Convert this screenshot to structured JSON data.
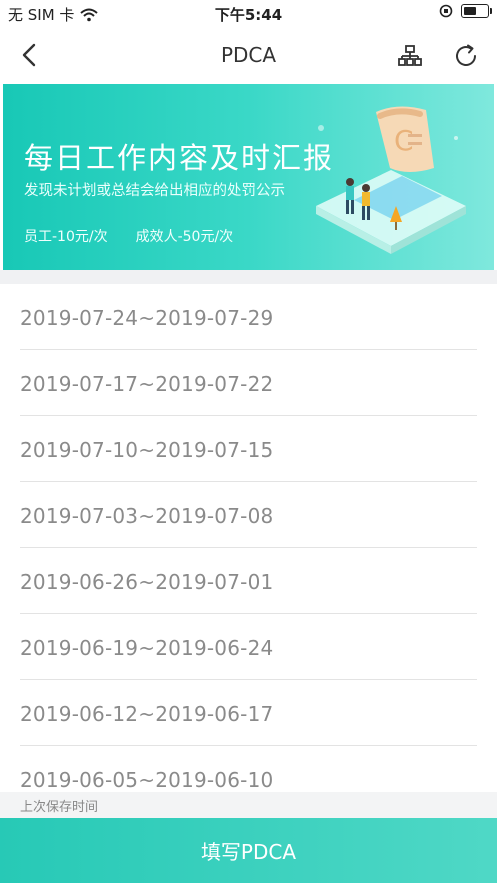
{
  "status_bar": {
    "carrier": "无 SIM 卡",
    "time": "下午5:44"
  },
  "nav": {
    "title": "PDCA",
    "icons": [
      "back-chevron-icon",
      "org-chart-icon",
      "refresh-icon"
    ]
  },
  "banner": {
    "title": "每日工作内容及时汇报",
    "subtitle": "发现未计划或总结会给出相应的处罚公示",
    "penalty_staff": "员工-10元/次",
    "penalty_effective": "成效人-50元/次"
  },
  "periods": [
    "2019-07-24~2019-07-29",
    "2019-07-17~2019-07-22",
    "2019-07-10~2019-07-15",
    "2019-07-03~2019-07-08",
    "2019-06-26~2019-07-01",
    "2019-06-19~2019-06-24",
    "2019-06-12~2019-06-17",
    "2019-06-05~2019-06-10"
  ],
  "footer": {
    "last_saved_label": "上次保存时间",
    "fill_button": "填写PDCA"
  },
  "colors": {
    "accent": "#2dcbb8",
    "row_text": "#8a8a8a"
  }
}
